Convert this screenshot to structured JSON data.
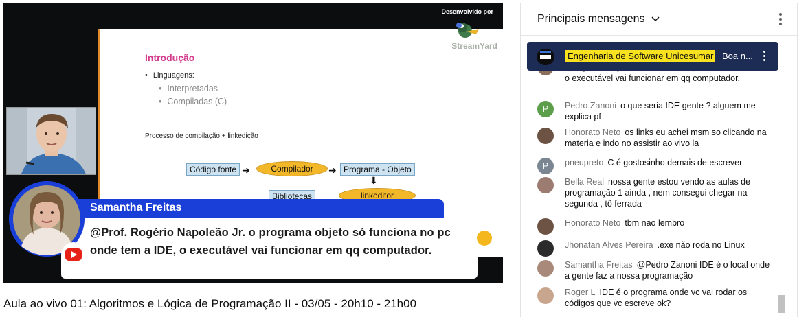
{
  "video": {
    "title": "Aula ao vivo 01: Algoritmos e Lógica de Programação II - 03/05 - 20h10 - 21h00",
    "branding": {
      "developed_by": "Desenvolvido por",
      "logo_text": "StreamYard"
    },
    "slide": {
      "heading": "Introdução",
      "bullet": "Linguagens:",
      "sub_items": [
        "Interpretadas",
        "Compiladas (C)"
      ],
      "process_label": "Processo de compilação + linkedição",
      "flow": {
        "source": "Código fonte",
        "compiler": "Compilador",
        "object_program": "Programa - Objeto",
        "libraries": "Bibliotecas",
        "linker": "linkeditor"
      }
    },
    "featured_comment": {
      "author": "Samantha Freitas",
      "text": "@Prof. Rogério Napoleão Jr. o programa objeto só funciona no pc onde tem a IDE, o executável vai funcionar em qq computador."
    }
  },
  "chat": {
    "header_title": "Principais mensagens",
    "pinned": {
      "author": "Engenharia de Software Unicesumar",
      "message": "Boa n..."
    },
    "messages": [
      {
        "author": "",
        "text": "programa objeto só funciona no pc onde tem a IDE, o executável vai funcionar em qq computador.",
        "avatar": "person-icon",
        "avatar_color": "#8a6d5a"
      },
      {
        "author": "Pedro Zanoni",
        "text": "o que seria IDE gente ? alguem me explica pf",
        "avatar": "letter-P",
        "avatar_color": "#5d9e4a",
        "avatar_letter": "P"
      },
      {
        "author": "Honorato Neto",
        "text": "os links eu achei msm so clicando na materia e indo no assistir ao vivo la",
        "avatar": "person-icon",
        "avatar_color": "#6d5344"
      },
      {
        "author": "pneupreto",
        "text": "C é gostosinho demais de escrever",
        "avatar": "letter-P",
        "avatar_color": "#7a8793",
        "avatar_letter": "P"
      },
      {
        "author": "Bella Real",
        "text": "nossa gente estou vendo as aulas de programação 1 ainda , nem consegui chegar na segunda , tô ferrada",
        "avatar": "person-icon",
        "avatar_color": "#9c7b70"
      },
      {
        "author": "Honorato Neto",
        "text": "tbm nao lembro",
        "avatar": "person-icon",
        "avatar_color": "#6d5344"
      },
      {
        "author": "Jhonatan Alves Pereira",
        "text": ".exe não roda no Linux",
        "avatar": "person-icon",
        "avatar_color": "#2b2b2b"
      },
      {
        "author": "Samantha Freitas",
        "text": "@Pedro Zanoni IDE é o local onde a gente faz a nossa programação",
        "avatar": "person-icon",
        "avatar_color": "#a98a7a"
      },
      {
        "author": "Roger L",
        "text": "IDE é o programa onde vc vai rodar os códigos que vc escreve ok?",
        "avatar": "person-icon",
        "avatar_color": "#c8a58d"
      }
    ]
  },
  "colors": {
    "streamyard_blue": "#1a3fd8",
    "pinned_bg": "#1d2c55",
    "member_badge_yellow": "#f8e11f",
    "youtube_red": "#e62117",
    "slide_heading": "#d23a8c"
  }
}
